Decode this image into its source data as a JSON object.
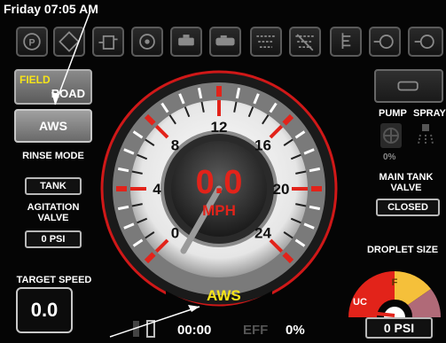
{
  "header": {
    "clock": "Friday 07:05 AM"
  },
  "toolbar_icons": [
    "park-icon",
    "diamond-icon",
    "tank-fill-icon",
    "engine-icon",
    "pump-icon",
    "sprayer-icon",
    "boom-section-icon",
    "boom-off-icon",
    "nozzle-icon",
    "spray-flow-icon",
    "tank-icon"
  ],
  "left": {
    "field_label": "FIELD",
    "road_label": "ROAD",
    "aws_button": "AWS",
    "rinse_mode_label": "RINSE MODE",
    "rinse_mode_value": "TANK",
    "agitation_label": "AGITATION VALVE",
    "agitation_value": "0 PSI",
    "target_speed_label": "TARGET SPEED",
    "target_speed_value": "0.0"
  },
  "gauge": {
    "speed": "0.0",
    "unit": "MPH",
    "ticks": [
      "0",
      "4",
      "8",
      "12",
      "16",
      "20",
      "24"
    ],
    "mode": "AWS"
  },
  "bottom": {
    "timer": "00:00",
    "eff_label": "EFF",
    "eff_value": "0%"
  },
  "right": {
    "pump_label": "PUMP",
    "spray_label": "SPRAY",
    "pump_percent": "0%",
    "main_tank_label": "MAIN TANK VALVE",
    "main_tank_value": "CLOSED",
    "droplet_label": "DROPLET SIZE",
    "droplet_f": "F",
    "droplet_uc": "UC",
    "pressure": "0 PSI"
  },
  "colors": {
    "accent_red": "#e2231a",
    "accent_yellow": "#f6e41a"
  }
}
